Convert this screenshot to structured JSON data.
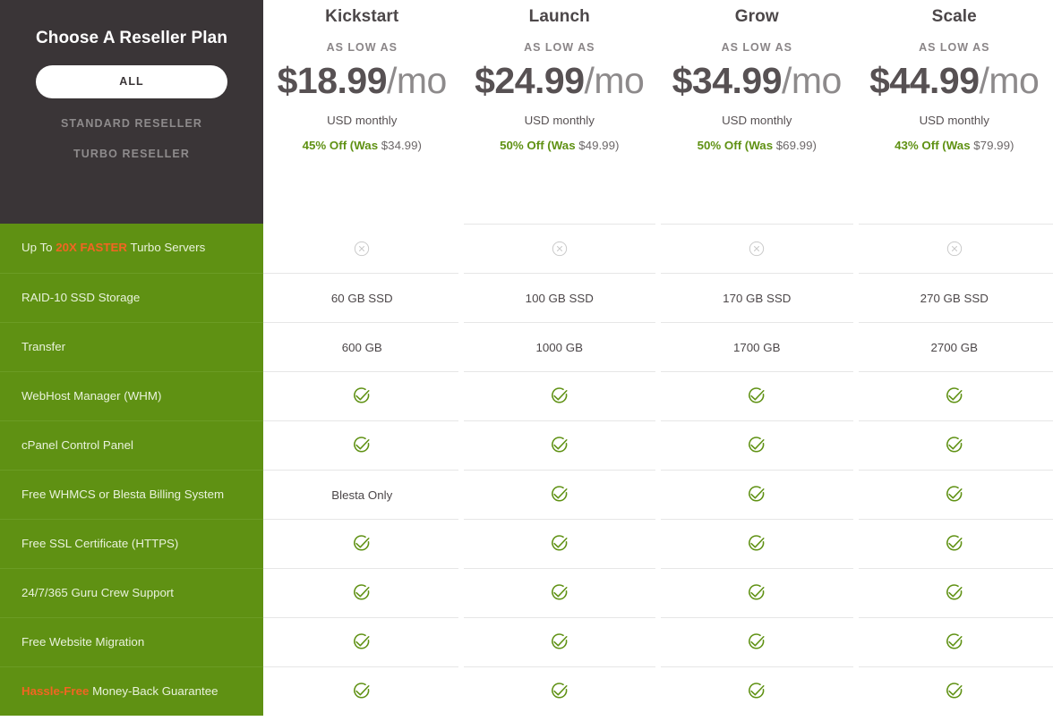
{
  "chooser": {
    "title": "Choose A Reseller Plan",
    "active_filter": "ALL",
    "filters": [
      {
        "label": "ALL",
        "active": true
      },
      {
        "label": "STANDARD RESELLER",
        "active": false
      },
      {
        "label": "TURBO RESELLER",
        "active": false
      }
    ]
  },
  "colors": {
    "green": "#5f9113",
    "orange": "#f26522",
    "dark": "#3a3537",
    "check": "#5f9113",
    "cross": "#c9c9c9"
  },
  "plans": [
    {
      "name": "Kickstart",
      "as_low_as": "AS LOW AS",
      "price_amount": "$18.99",
      "price_period": "/mo",
      "currency_note": "USD monthly",
      "discount_off": "45% Off (Was",
      "discount_was": "$34.99)"
    },
    {
      "name": "Launch",
      "as_low_as": "AS LOW AS",
      "price_amount": "$24.99",
      "price_period": "/mo",
      "currency_note": "USD monthly",
      "discount_off": "50% Off (Was",
      "discount_was": "$49.99)"
    },
    {
      "name": "Grow",
      "as_low_as": "AS LOW AS",
      "price_amount": "$34.99",
      "price_period": "/mo",
      "currency_note": "USD monthly",
      "discount_off": "50% Off (Was",
      "discount_was": "$69.99)"
    },
    {
      "name": "Scale",
      "as_low_as": "AS LOW AS",
      "price_amount": "$44.99",
      "price_period": "/mo",
      "currency_note": "USD monthly",
      "discount_off": "43% Off (Was",
      "discount_was": "$79.99)"
    }
  ],
  "features": [
    {
      "label_pre": "Up To ",
      "label_hl": "20X FASTER",
      "label_post": " Turbo Servers",
      "values": [
        "cross",
        "cross",
        "cross",
        "cross"
      ]
    },
    {
      "label_pre": "RAID-10 SSD Storage",
      "label_hl": "",
      "label_post": "",
      "values": [
        "60 GB SSD",
        "100 GB SSD",
        "170 GB SSD",
        "270 GB SSD"
      ]
    },
    {
      "label_pre": "Transfer",
      "label_hl": "",
      "label_post": "",
      "values": [
        "600 GB",
        "1000 GB",
        "1700 GB",
        "2700 GB"
      ]
    },
    {
      "label_pre": "WebHost Manager (WHM)",
      "label_hl": "",
      "label_post": "",
      "values": [
        "check",
        "check",
        "check",
        "check"
      ]
    },
    {
      "label_pre": "cPanel Control Panel",
      "label_hl": "",
      "label_post": "",
      "values": [
        "check",
        "check",
        "check",
        "check"
      ]
    },
    {
      "label_pre": "Free WHMCS or Blesta Billing System",
      "label_hl": "",
      "label_post": "",
      "values": [
        "Blesta Only",
        "check",
        "check",
        "check"
      ]
    },
    {
      "label_pre": "Free SSL Certificate (HTTPS)",
      "label_hl": "",
      "label_post": "",
      "values": [
        "check",
        "check",
        "check",
        "check"
      ]
    },
    {
      "label_pre": "24/7/365 Guru Crew Support",
      "label_hl": "",
      "label_post": "",
      "values": [
        "check",
        "check",
        "check",
        "check"
      ]
    },
    {
      "label_pre": "Free Website Migration",
      "label_hl": "",
      "label_post": "",
      "values": [
        "check",
        "check",
        "check",
        "check"
      ]
    },
    {
      "label_hl": "Hassle-Free",
      "label_pre": "",
      "label_post": " Money-Back Guarantee",
      "values": [
        "check",
        "check",
        "check",
        "check"
      ]
    }
  ]
}
